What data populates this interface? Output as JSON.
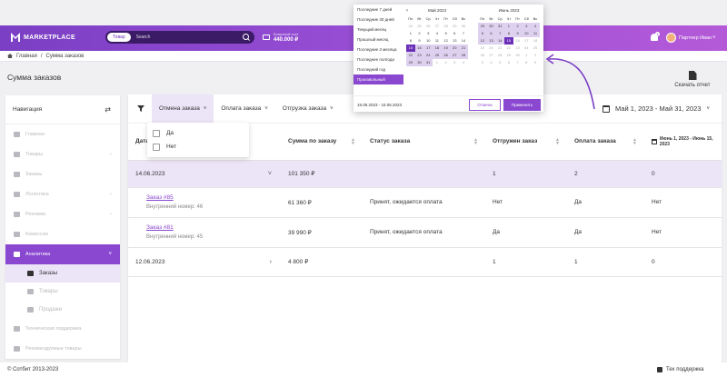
{
  "header": {
    "logo": "MARKETPLACE",
    "search_scope": "Товар",
    "search_placeholder": "Search",
    "balance_label": "Бонусный счет",
    "balance_value": "440.000 ₽",
    "notifications_count": "1",
    "user_name": "Партнер Иван"
  },
  "breadcrumb": {
    "home": "Главная",
    "separator": "/",
    "current": "Сумма заказов"
  },
  "page": {
    "title": "Сумма заказов",
    "report_button": "Скачать отчет"
  },
  "sidebar": {
    "title": "Навигация",
    "items": [
      {
        "label": "Главная",
        "icon": "home-icon",
        "arrow": ""
      },
      {
        "label": "Товары",
        "icon": "box-icon",
        "arrow": "›"
      },
      {
        "label": "Заказы",
        "icon": "cart-icon",
        "arrow": ""
      },
      {
        "label": "Логистика",
        "icon": "truck-icon",
        "arrow": "›"
      },
      {
        "label": "Реклама",
        "icon": "megaphone-icon",
        "arrow": "›"
      },
      {
        "label": "Комиссии",
        "icon": "percent-icon",
        "arrow": ""
      }
    ],
    "active_item": {
      "label": "Аналитика",
      "icon": "chart-icon",
      "arrow": "˅"
    },
    "subitems": [
      {
        "label": "Заказы",
        "active": true
      },
      {
        "label": "Товары",
        "active": false
      },
      {
        "label": "Продажи",
        "active": false
      }
    ],
    "bottom_items": [
      {
        "label": "Техническая поддержка",
        "icon": "support-icon"
      },
      {
        "label": "Рекомендуемые товары",
        "icon": "star-icon"
      }
    ]
  },
  "filters": {
    "tabs": [
      "Отмена заказа",
      "Оплата заказа",
      "Отгрузка заказа"
    ],
    "caret": "˅",
    "dropdown_options": [
      "Да",
      "Нет"
    ],
    "date_range": "Май 1, 2023 - Май 31, 2023"
  },
  "table": {
    "headers": [
      "Дата",
      "Сумма по заказу",
      "Статус заказа",
      "Отгружен заказ",
      "Оплата заказа"
    ],
    "extra_header": "Июнь 1, 2023 - Июнь 15, 2023",
    "rows": [
      {
        "kind": "group",
        "date": "14.06.2023",
        "chevron": "˅",
        "sum": "101 350 ₽",
        "status": "",
        "shipped": "1",
        "paid": "2",
        "extra": "0"
      },
      {
        "kind": "order",
        "title": "Заказ #85",
        "sub": "Внутренний номер: 46",
        "sum": "61 360 ₽",
        "status": "Принят, ожидается оплата",
        "shipped": "Нет",
        "paid": "Да",
        "extra": "Нет"
      },
      {
        "kind": "order",
        "title": "Заказ #81",
        "sub": "Внутренний номер: 45",
        "sum": "39 990 ₽",
        "status": "Принят, ожидается оплата",
        "shipped": "Да",
        "paid": "Да",
        "extra": "Нет"
      },
      {
        "kind": "group2",
        "date": "12.06.2023",
        "chevron": "›",
        "sum": "4 800 ₽",
        "status": "",
        "shipped": "1",
        "paid": "1",
        "extra": "0"
      }
    ]
  },
  "datepicker": {
    "presets": [
      "Последние 7 дней",
      "Последние 30 дней",
      "Текущий месяц",
      "Прошлый месяц",
      "Последние 3 месяца",
      "Последнее полгода",
      "Последний год",
      "Произвольный"
    ],
    "active_preset": 7,
    "weekdays": [
      "Пн",
      "Вт",
      "Ср",
      "Чт",
      "Пт",
      "Сб",
      "Вс"
    ],
    "left_month": "Май 2023",
    "right_month": "Июнь 2023",
    "prev_symbol": "‹",
    "left_days": [
      "24",
      "25",
      "26",
      "27",
      "28",
      "29",
      "30",
      "1",
      "2",
      "3",
      "4",
      "5",
      "6",
      "7",
      "8",
      "9",
      "10",
      "11",
      "12",
      "13",
      "14",
      "15",
      "16",
      "17",
      "18",
      "19",
      "20",
      "21",
      "22",
      "23",
      "24",
      "25",
      "26",
      "27",
      "28",
      "29",
      "30",
      "31",
      "1",
      "2",
      "3",
      "4"
    ],
    "right_days": [
      "29",
      "30",
      "31",
      "1",
      "2",
      "3",
      "4",
      "5",
      "6",
      "7",
      "8",
      "9",
      "10",
      "11",
      "12",
      "13",
      "14",
      "15",
      "16",
      "17",
      "18",
      "19",
      "20",
      "21",
      "22",
      "23",
      "24",
      "25",
      "26",
      "27",
      "28",
      "29",
      "30",
      "1",
      "2",
      "3",
      "4",
      "5",
      "6",
      "7",
      "8",
      "9"
    ],
    "range_text": "15.05.2023 - 15.06.2023",
    "cancel": "Отмена",
    "apply": "Применить"
  },
  "footer": {
    "copyright": "© Сотбит 2013-2023",
    "support": "Тех поддержка"
  },
  "colors": {
    "accent": "#8a47d0",
    "header_start": "#7a3fc4",
    "header_end": "#b45ad8",
    "selection": "#ece4f7"
  }
}
